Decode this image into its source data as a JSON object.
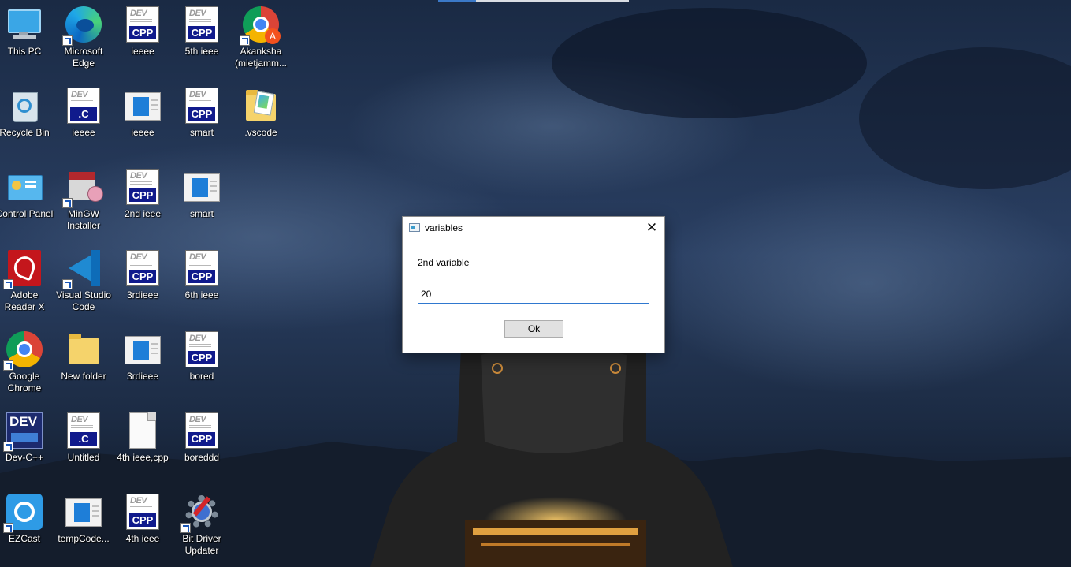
{
  "desktop": {
    "icons": [
      {
        "label": "This PC"
      },
      {
        "label": "Microsoft Edge"
      },
      {
        "label": "ieeee"
      },
      {
        "label": "5th ieee"
      },
      {
        "label": "Akanksha (mietjamm..."
      },
      {
        "label": "Recycle Bin"
      },
      {
        "label": "ieeee"
      },
      {
        "label": "ieeee"
      },
      {
        "label": "smart"
      },
      {
        "label": ".vscode"
      },
      {
        "label": "Control Panel"
      },
      {
        "label": "MinGW Installer"
      },
      {
        "label": "2nd ieee"
      },
      {
        "label": "smart"
      },
      {
        "label": "Adobe Reader X"
      },
      {
        "label": "Visual Studio Code"
      },
      {
        "label": "3rdieee"
      },
      {
        "label": "6th ieee"
      },
      {
        "label": "Google Chrome"
      },
      {
        "label": "New folder"
      },
      {
        "label": "3rdieee"
      },
      {
        "label": "bored"
      },
      {
        "label": "Dev-C++"
      },
      {
        "label": "Untitled"
      },
      {
        "label": "4th ieee,cpp"
      },
      {
        "label": "boreddd"
      },
      {
        "label": "EZCast"
      },
      {
        "label": "tempCode..."
      },
      {
        "label": "4th ieee"
      },
      {
        "label": "Bit Driver Updater"
      }
    ],
    "file_badges": {
      "cpp": "CPP",
      "c": ".C",
      "dev": "DEV"
    },
    "avatar_letter": "A"
  },
  "dialog": {
    "title": "variables",
    "close_glyph": "✕",
    "prompt": "2nd variable",
    "input_value": "20",
    "ok_label": "Ok"
  },
  "colors": {
    "accent": "#2f78cf",
    "dev_band": "#101a8c",
    "dialog_bg": "#ffffff",
    "button_bg": "#e1e1e1"
  }
}
